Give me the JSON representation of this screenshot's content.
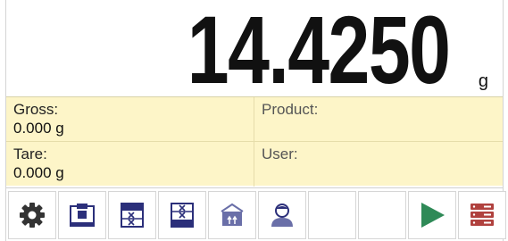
{
  "display": {
    "weight_value": "14.4250",
    "weight_unit": "g"
  },
  "info": {
    "gross_label": "Gross:",
    "gross_value": "0.000 g",
    "tare_label": "Tare:",
    "tare_value": "0.000 g",
    "product_label": "Product:",
    "product_value": "",
    "user_label": "User:",
    "user_value": ""
  },
  "toolbar": {
    "buttons": [
      {
        "icon": "gear-icon"
      },
      {
        "icon": "scale-tare-icon"
      },
      {
        "icon": "database-cross-icon"
      },
      {
        "icon": "database-cross-alt-icon"
      },
      {
        "icon": "package-icon"
      },
      {
        "icon": "user-icon"
      },
      {
        "icon": ""
      },
      {
        "icon": ""
      },
      {
        "icon": "play-icon"
      },
      {
        "icon": "server-icon"
      }
    ]
  },
  "colors": {
    "info_background": "#fdf5c8",
    "accent_navy": "#2b2f7a",
    "play_green": "#2f8a57",
    "server_red": "#b0413e"
  }
}
